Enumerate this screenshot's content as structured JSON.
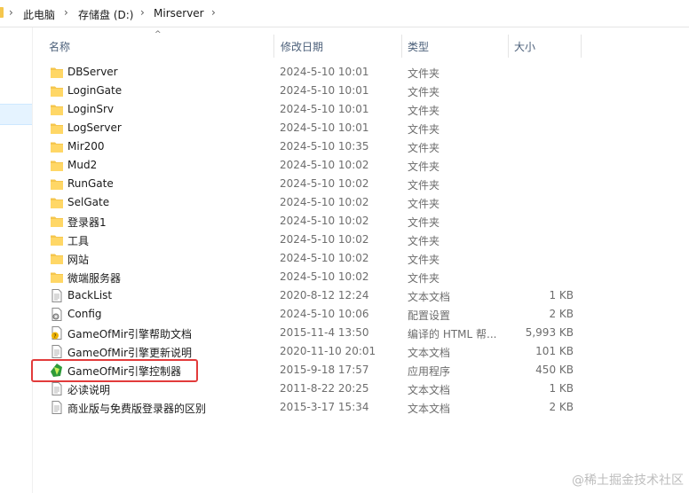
{
  "breadcrumb": [
    "此电脑",
    "存储盘 (D:)",
    "Mirserver"
  ],
  "columns": {
    "name": "名称",
    "date": "修改日期",
    "type": "类型",
    "size": "大小"
  },
  "files": [
    {
      "name": "DBServer",
      "date": "2024-5-10 10:01",
      "type": "文件夹",
      "size": "",
      "icon": "folder-icon"
    },
    {
      "name": "LoginGate",
      "date": "2024-5-10 10:01",
      "type": "文件夹",
      "size": "",
      "icon": "folder-icon"
    },
    {
      "name": "LoginSrv",
      "date": "2024-5-10 10:01",
      "type": "文件夹",
      "size": "",
      "icon": "folder-icon"
    },
    {
      "name": "LogServer",
      "date": "2024-5-10 10:01",
      "type": "文件夹",
      "size": "",
      "icon": "folder-icon"
    },
    {
      "name": "Mir200",
      "date": "2024-5-10 10:35",
      "type": "文件夹",
      "size": "",
      "icon": "folder-icon"
    },
    {
      "name": "Mud2",
      "date": "2024-5-10 10:02",
      "type": "文件夹",
      "size": "",
      "icon": "folder-icon"
    },
    {
      "name": "RunGate",
      "date": "2024-5-10 10:02",
      "type": "文件夹",
      "size": "",
      "icon": "folder-icon"
    },
    {
      "name": "SelGate",
      "date": "2024-5-10 10:02",
      "type": "文件夹",
      "size": "",
      "icon": "folder-icon"
    },
    {
      "name": "登录器1",
      "date": "2024-5-10 10:02",
      "type": "文件夹",
      "size": "",
      "icon": "folder-icon"
    },
    {
      "name": "工具",
      "date": "2024-5-10 10:02",
      "type": "文件夹",
      "size": "",
      "icon": "folder-icon"
    },
    {
      "name": "网站",
      "date": "2024-5-10 10:02",
      "type": "文件夹",
      "size": "",
      "icon": "folder-icon"
    },
    {
      "name": "微端服务器",
      "date": "2024-5-10 10:02",
      "type": "文件夹",
      "size": "",
      "icon": "folder-icon"
    },
    {
      "name": "BackList",
      "date": "2020-8-12 12:24",
      "type": "文本文档",
      "size": "1 KB",
      "icon": "text-document-icon"
    },
    {
      "name": "Config",
      "date": "2024-5-10 10:06",
      "type": "配置设置",
      "size": "2 KB",
      "icon": "config-settings-icon"
    },
    {
      "name": "GameOfMir引擎帮助文档",
      "date": "2015-11-4 13:50",
      "type": "编译的 HTML 帮...",
      "size": "5,993 KB",
      "icon": "help-document-icon"
    },
    {
      "name": "GameOfMir引擎更新说明",
      "date": "2020-11-10 20:01",
      "type": "文本文档",
      "size": "101 KB",
      "icon": "text-document-icon"
    },
    {
      "name": "GameOfMir引擎控制器",
      "date": "2015-9-18 17:57",
      "type": "应用程序",
      "size": "450 KB",
      "icon": "application-icon"
    },
    {
      "name": "必读说明",
      "date": "2011-8-22 20:25",
      "type": "文本文档",
      "size": "1 KB",
      "icon": "text-document-icon"
    },
    {
      "name": "商业版与免费版登录器的区别",
      "date": "2015-3-17 15:34",
      "type": "文本文档",
      "size": "2 KB",
      "icon": "text-document-icon"
    }
  ],
  "watermark": "@稀土掘金技术社区",
  "colors": {
    "folder": "#f5c64d",
    "highlight_border": "#e23b3b",
    "header_text": "#4c607a"
  }
}
